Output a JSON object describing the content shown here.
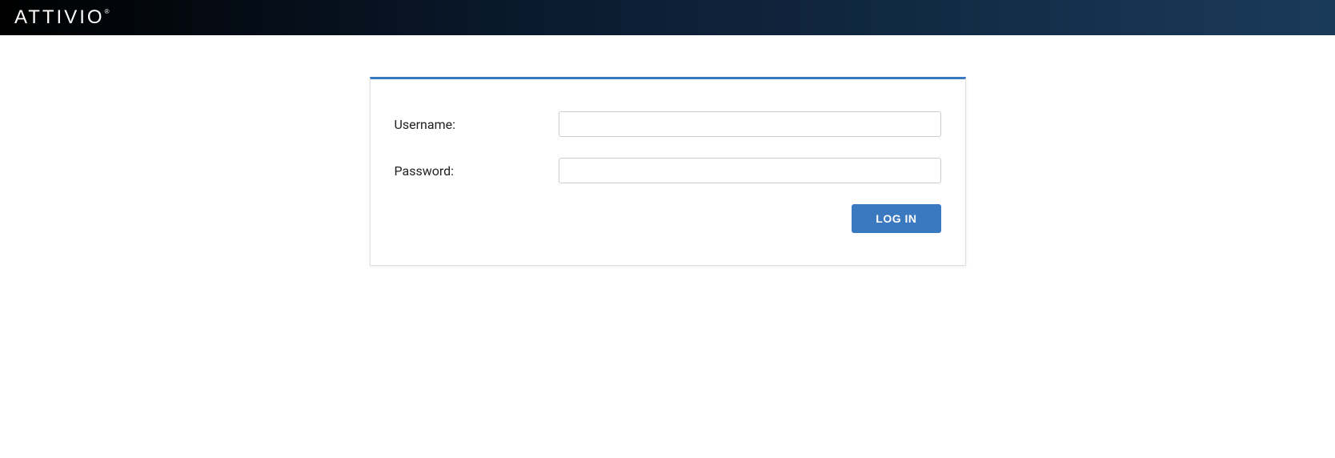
{
  "header": {
    "brand": "ATTIVIO"
  },
  "login": {
    "username_label": "Username:",
    "username_value": "",
    "password_label": "Password:",
    "password_value": "",
    "login_button_label": "LOG IN"
  }
}
